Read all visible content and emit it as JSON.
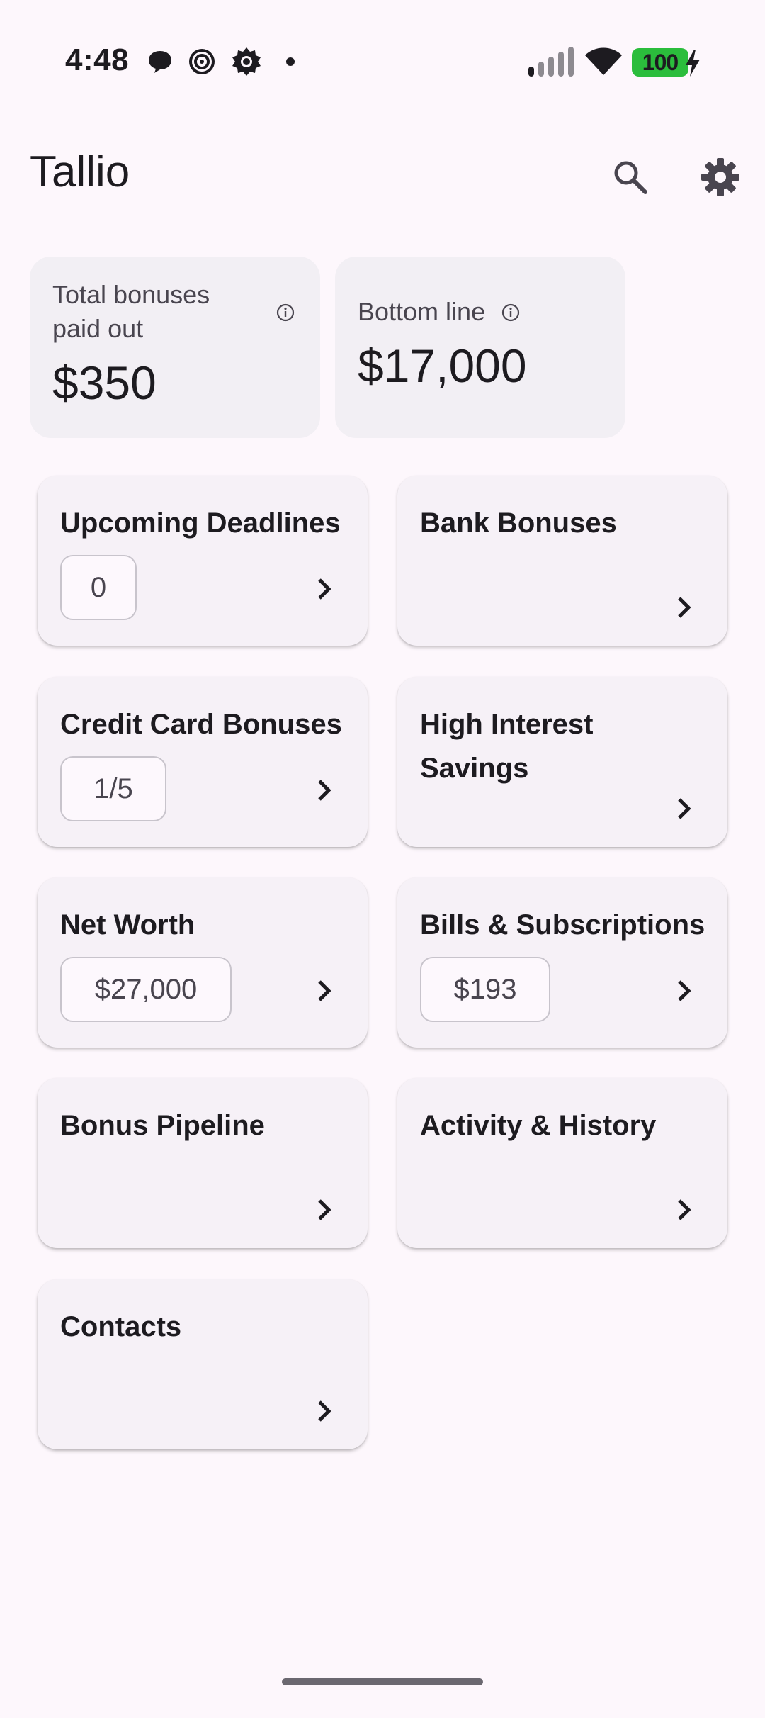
{
  "status_bar": {
    "time": "4:48",
    "battery": "100",
    "battery_color": "#2bbd3c"
  },
  "app_bar": {
    "title": "Tallio",
    "actions": [
      "search-icon",
      "settings-gear-icon"
    ]
  },
  "summary": [
    {
      "label": "Total bonuses paid out",
      "value": "$350",
      "icon": "info-icon"
    },
    {
      "label": "Bottom line",
      "value": "$17,000",
      "icon": "info-icon"
    }
  ],
  "tiles": [
    {
      "title": "Upcoming Deadlines",
      "chip": "0"
    },
    {
      "title": "Bank Bonuses",
      "chip": null
    },
    {
      "title": "Credit Card Bonuses",
      "chip": "1/5"
    },
    {
      "title": "High Interest Savings",
      "chip": null
    },
    {
      "title": "Net Worth",
      "chip": "$27,000"
    },
    {
      "title": "Bills & Subscriptions",
      "chip": "$193"
    },
    {
      "title": "Bonus Pipeline",
      "chip": null
    },
    {
      "title": "Activity & History",
      "chip": null
    },
    {
      "title": "Contacts",
      "chip": null
    }
  ]
}
